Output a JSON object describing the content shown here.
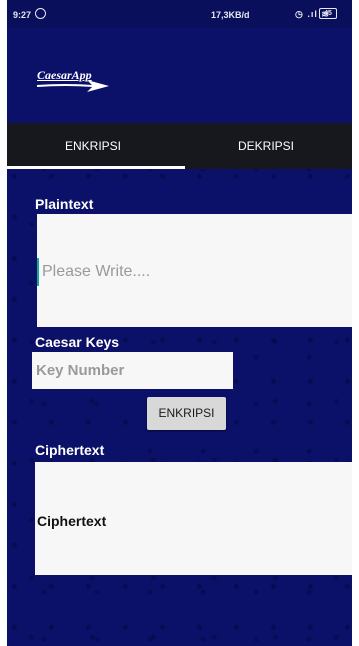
{
  "status_bar": {
    "time": "9:27",
    "speed": "17,3KB/d",
    "signal_icons": "◷ .ıl ≋",
    "battery": "45"
  },
  "app": {
    "logo_text": "CaesarApp"
  },
  "tabs": [
    {
      "label": "ENKRIPSI",
      "selected": true
    },
    {
      "label": "DEKRIPSI",
      "selected": false
    }
  ],
  "form": {
    "plaintext_label": "Plaintext",
    "plaintext_placeholder": "Please Write....",
    "keys_label": "Caesar Keys",
    "key_placeholder": "Key Number",
    "encrypt_button": "ENKRIPSI",
    "ciphertext_label": "Ciphertext",
    "ciphertext_value": "Ciphertext"
  },
  "colors": {
    "background": "#0b1168",
    "tab_bar": "#17181d",
    "accent_cursor": "#1aa59b"
  }
}
